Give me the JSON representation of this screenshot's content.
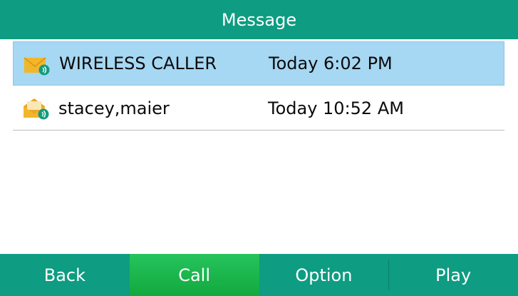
{
  "title": "Message",
  "messages": [
    {
      "name": "WIRELESS CALLER",
      "time": "Today 6:02 PM",
      "icon": "voicemail-envelope-icon",
      "selected": true
    },
    {
      "name": "stacey,maier",
      "time": "Today 10:52 AM",
      "icon": "voicemail-envelope-open-icon",
      "selected": false
    }
  ],
  "softkeys": {
    "back": "Back",
    "call": "Call",
    "option": "Option",
    "play": "Play"
  },
  "colors": {
    "header": "#0e9c82",
    "selected_row": "#a6d7f3",
    "active_softkey": "#1ab14c",
    "envelope": "#f2b62b",
    "badge": "#129b7f"
  }
}
